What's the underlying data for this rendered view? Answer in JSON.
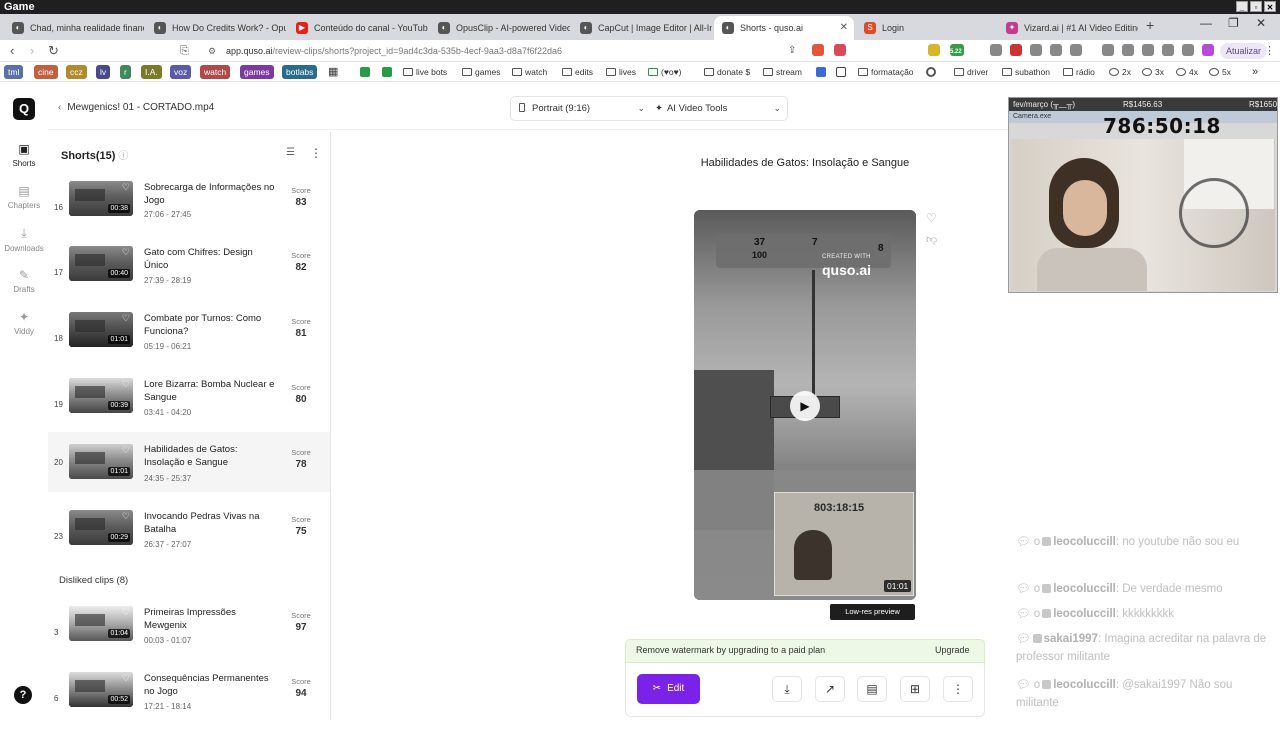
{
  "os_title": "Game",
  "browser": {
    "tabs": [
      {
        "title": "Chad, minha realidade finance",
        "icon_color": "#555"
      },
      {
        "title": "How Do Credits Work? - Opus",
        "icon_color": "#555"
      },
      {
        "title": "Conteúdo do canal - YouTube",
        "icon_color": "#e62117"
      },
      {
        "title": "OpusClip - AI-powered Video",
        "icon_color": "#555"
      },
      {
        "title": "CapCut | Image Editor | All-In",
        "icon_color": "#555"
      },
      {
        "title": "Shorts - quso.ai",
        "icon_color": "#555"
      },
      {
        "title": "Login",
        "icon_color": "#e04b2c"
      },
      {
        "title": "Vizard.ai | #1 AI Video Editing",
        "icon_color": "#c43c8f"
      }
    ],
    "url_domain": "app.quso.ai",
    "url_path": "/review-clips/shorts?project_id=9ad4c3da-535b-4ecf-9aa3-d8a7f6f22da6",
    "ext_badge": "5.22",
    "update_label": "Atualizar",
    "bookmarks_tags": [
      {
        "label": "tml",
        "color": "#5b6fa8"
      },
      {
        "label": "cine",
        "color": "#c06040"
      },
      {
        "label": "ccz",
        "color": "#b08a2c"
      },
      {
        "label": "lv",
        "color": "#4a4a8a"
      },
      {
        "label": "r",
        "color": "#3f8a5a"
      },
      {
        "label": "I.A.",
        "color": "#7a7a2a"
      },
      {
        "label": "voz",
        "color": "#5a5aa5"
      },
      {
        "label": "watch",
        "color": "#b04a4a"
      },
      {
        "label": "games",
        "color": "#7a3aa0"
      },
      {
        "label": "botlabs",
        "color": "#2a6a8a"
      }
    ],
    "bookmarks": [
      "live bots",
      "games",
      "watch",
      "edits",
      "lives",
      "(♥o♥)",
      "donate $",
      "stream",
      "formatação",
      "driver",
      "subathon",
      "rádio",
      "2x",
      "3x",
      "4x",
      "5x"
    ]
  },
  "app": {
    "nav": [
      {
        "label": "Shorts",
        "icon": "film-icon"
      },
      {
        "label": "Chapters",
        "icon": "chapters-icon"
      },
      {
        "label": "Downloads",
        "icon": "download-icon"
      },
      {
        "label": "Drafts",
        "icon": "drafts-icon"
      },
      {
        "label": "Viddy",
        "icon": "sparkle-icon"
      }
    ],
    "back_label": "Mewgenics! 01 - CORTADO.mp4",
    "format_label": "Portrait (9:16)",
    "tools_label": "AI Video Tools",
    "shorts_header": "Shorts(15)",
    "score_label": "Score",
    "clips": [
      {
        "num": "16",
        "title": "Sobrecarga de Informações no Jogo",
        "time": "27:06 - 27:45",
        "duration": "00:38",
        "score": "83"
      },
      {
        "num": "17",
        "title": "Gato com Chifres: Design Único",
        "time": "27:39 - 28:19",
        "duration": "00:40",
        "score": "82"
      },
      {
        "num": "18",
        "title": "Combate por Turnos: Como Funciona?",
        "time": "05:19 - 06:21",
        "duration": "01:01",
        "score": "81"
      },
      {
        "num": "19",
        "title": "Lore Bizarra: Bomba Nuclear e Sangue",
        "time": "03:41 - 04:20",
        "duration": "00:39",
        "score": "80"
      },
      {
        "num": "20",
        "title": "Habilidades de Gatos: Insolação e Sangue",
        "time": "24:35 - 25:37",
        "duration": "01:01",
        "score": "78"
      },
      {
        "num": "23",
        "title": "Invocando Pedras Vivas na Batalha",
        "time": "26:37 - 27:07",
        "duration": "00:29",
        "score": "75"
      }
    ],
    "disliked_label": "Disliked clips (8)",
    "disliked": [
      {
        "num": "3",
        "title": "Primeiras Impressões Mewgenix",
        "time": "00:03 - 01:07",
        "duration": "01:04",
        "score": "97"
      },
      {
        "num": "6",
        "title": "Consequências Permanentes no Jogo",
        "time": "17:21 - 18:14",
        "duration": "00:52",
        "score": "94"
      }
    ],
    "clip_title": "Habilidades de Gatos: Insolação e Sangue",
    "video": {
      "hud1": "37",
      "hud1b": "100",
      "hud2": "7",
      "hud3": "8",
      "created_with": "CREATED WITH",
      "brand": "quso.ai",
      "cam_timer": "803:18:15",
      "duration": "01:01"
    },
    "lowres_label": "Low-res preview",
    "watermark_text": "Remove watermark by upgrading to a paid plan",
    "upgrade_label": "Upgrade",
    "edit_label": "Edit"
  },
  "overlay": {
    "webcam_title": "fev/março (╥﹏╥)",
    "webcam_amount": "R$1456.63",
    "webcam_goal": "R$1650",
    "webcam_window": "Camera.exe",
    "timer": "786:50:18",
    "chat": [
      {
        "user": "leocoluccill",
        "msg": ": no youtube não sou eu"
      },
      {
        "user": "leocoluccill",
        "msg": ": De verdade mesmo"
      },
      {
        "user": "leocoluccill",
        "msg": ": kkkkkkkkk"
      },
      {
        "user": "sakai1997",
        "msg": ": Imagina acreditar na palavra de professor militante"
      },
      {
        "user": "leocoluccill",
        "msg": ": @sakai1997 Não sou militante"
      }
    ]
  }
}
